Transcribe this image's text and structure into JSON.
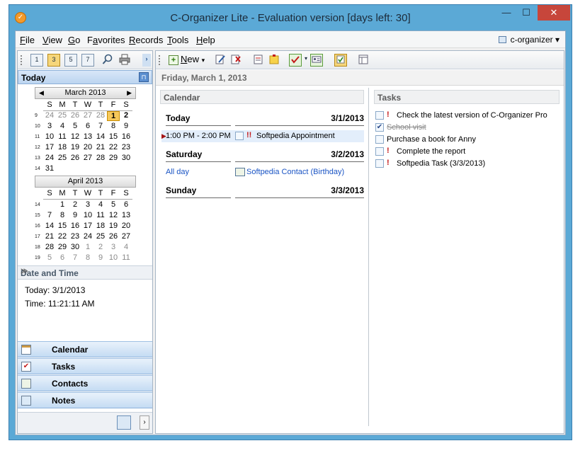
{
  "window": {
    "title": "C-Organizer Lite - Evaluation version [days left: 30]",
    "min": "—",
    "max": "☐",
    "close": "✕"
  },
  "menu": [
    {
      "pre": "",
      "u": "F",
      "post": "ile"
    },
    {
      "pre": "",
      "u": "V",
      "post": "iew"
    },
    {
      "pre": "",
      "u": "G",
      "post": "o"
    },
    {
      "pre": "F",
      "u": "a",
      "post": "vorites"
    },
    {
      "pre": "",
      "u": "R",
      "post": "ecords"
    },
    {
      "pre": "",
      "u": "T",
      "post": "ools"
    },
    {
      "pre": "",
      "u": "H",
      "post": "elp"
    }
  ],
  "profile": {
    "name": "c-organizer",
    "arrow": "▾"
  },
  "lefttool": {
    "icons": [
      "1",
      "3",
      "5",
      "7"
    ],
    "more": "›"
  },
  "today_header": {
    "label": "Today",
    "pin": "⊓"
  },
  "march": {
    "label": "March 2013",
    "prev": "◀",
    "next": "▶",
    "weekdays": [
      "S",
      "M",
      "T",
      "W",
      "T",
      "F",
      "S"
    ],
    "weeks": [
      {
        "n": "9",
        "days": [
          {
            "d": "24",
            "o": true
          },
          {
            "d": "25",
            "o": true
          },
          {
            "d": "26",
            "o": true
          },
          {
            "d": "27",
            "o": true
          },
          {
            "d": "28",
            "o": true
          },
          {
            "d": "1",
            "t": true
          },
          {
            "d": "2",
            "b": true
          }
        ]
      },
      {
        "n": "10",
        "days": [
          {
            "d": "3"
          },
          {
            "d": "4"
          },
          {
            "d": "5"
          },
          {
            "d": "6"
          },
          {
            "d": "7"
          },
          {
            "d": "8"
          },
          {
            "d": "9"
          }
        ]
      },
      {
        "n": "11",
        "days": [
          {
            "d": "10"
          },
          {
            "d": "11"
          },
          {
            "d": "12"
          },
          {
            "d": "13"
          },
          {
            "d": "14"
          },
          {
            "d": "15"
          },
          {
            "d": "16"
          }
        ]
      },
      {
        "n": "12",
        "days": [
          {
            "d": "17"
          },
          {
            "d": "18"
          },
          {
            "d": "19"
          },
          {
            "d": "20"
          },
          {
            "d": "21"
          },
          {
            "d": "22"
          },
          {
            "d": "23"
          }
        ]
      },
      {
        "n": "13",
        "days": [
          {
            "d": "24"
          },
          {
            "d": "25"
          },
          {
            "d": "26"
          },
          {
            "d": "27"
          },
          {
            "d": "28"
          },
          {
            "d": "29"
          },
          {
            "d": "30"
          }
        ]
      },
      {
        "n": "14",
        "days": [
          {
            "d": "31"
          }
        ]
      }
    ]
  },
  "april": {
    "label": "April 2013",
    "weekdays": [
      "S",
      "M",
      "T",
      "W",
      "T",
      "F",
      "S"
    ],
    "weeks": [
      {
        "n": "14",
        "days": [
          {
            "d": ""
          },
          {
            "d": "1"
          },
          {
            "d": "2"
          },
          {
            "d": "3"
          },
          {
            "d": "4"
          },
          {
            "d": "5"
          },
          {
            "d": "6"
          }
        ]
      },
      {
        "n": "15",
        "days": [
          {
            "d": "7"
          },
          {
            "d": "8"
          },
          {
            "d": "9"
          },
          {
            "d": "10"
          },
          {
            "d": "11"
          },
          {
            "d": "12"
          },
          {
            "d": "13"
          }
        ]
      },
      {
        "n": "16",
        "days": [
          {
            "d": "14"
          },
          {
            "d": "15"
          },
          {
            "d": "16"
          },
          {
            "d": "17"
          },
          {
            "d": "18"
          },
          {
            "d": "19"
          },
          {
            "d": "20"
          }
        ]
      },
      {
        "n": "17",
        "days": [
          {
            "d": "21"
          },
          {
            "d": "22"
          },
          {
            "d": "23"
          },
          {
            "d": "24"
          },
          {
            "d": "25"
          },
          {
            "d": "26"
          },
          {
            "d": "27"
          }
        ]
      },
      {
        "n": "18",
        "days": [
          {
            "d": "28"
          },
          {
            "d": "29"
          },
          {
            "d": "30"
          },
          {
            "d": "1",
            "o": true
          },
          {
            "d": "2",
            "o": true
          },
          {
            "d": "3",
            "o": true
          },
          {
            "d": "4",
            "o": true
          }
        ]
      },
      {
        "n": "19",
        "days": [
          {
            "d": "5",
            "o": true
          },
          {
            "d": "6",
            "o": true
          },
          {
            "d": "7",
            "o": true
          },
          {
            "d": "8",
            "o": true
          },
          {
            "d": "9",
            "o": true
          },
          {
            "d": "10",
            "o": true
          },
          {
            "d": "11",
            "o": true
          }
        ]
      }
    ]
  },
  "datetime": {
    "header": "Date and Time",
    "chevron": "≫",
    "today": "Today: 3/1/2013",
    "time": "Time: 11:21:11 AM"
  },
  "nav": [
    {
      "label": "Calendar",
      "icon": "calendar-icon"
    },
    {
      "label": "Tasks",
      "icon": "tasks-icon"
    },
    {
      "label": "Contacts",
      "icon": "contacts-icon"
    },
    {
      "label": "Notes",
      "icon": "notes-icon"
    }
  ],
  "navfoot": {
    "more": "›"
  },
  "toolbar": {
    "new_label": "New",
    "new_u": "N",
    "new_rest": "ew",
    "plus": "+",
    "arrow": "▾"
  },
  "datebar": "Friday, March 1, 2013",
  "calendar": {
    "header": "Calendar",
    "days": [
      {
        "name": "Today",
        "date": "3/1/2013"
      },
      {
        "name": "Saturday",
        "date": "3/2/2013"
      },
      {
        "name": "Sunday",
        "date": "3/3/2013"
      }
    ],
    "appointment": {
      "time": "1:00 PM - 2:00 PM",
      "importance": "!!",
      "text": "Softpedia Appointment",
      "marker": "▶"
    },
    "contact_event": {
      "time": "All day",
      "text": "Softpedia Contact (Birthday)"
    }
  },
  "tasks": {
    "header": "Tasks",
    "items": [
      {
        "text": "Check the latest version of C-Organizer Pro",
        "important": true,
        "done": false
      },
      {
        "text": "School visit",
        "important": false,
        "done": true
      },
      {
        "text": "Purchase a book for Anny",
        "important": false,
        "done": false
      },
      {
        "text": "Complete the report",
        "important": true,
        "done": false
      },
      {
        "text": "Softpedia Task (3/3/2013)",
        "important": true,
        "done": false
      }
    ],
    "imp_mark": "!",
    "check_mark": "✔"
  },
  "colors": {
    "titlebar": "#5ba9d6",
    "close": "#c7463b",
    "today_highlight": "#f5c85a",
    "link": "#1a54c4"
  }
}
